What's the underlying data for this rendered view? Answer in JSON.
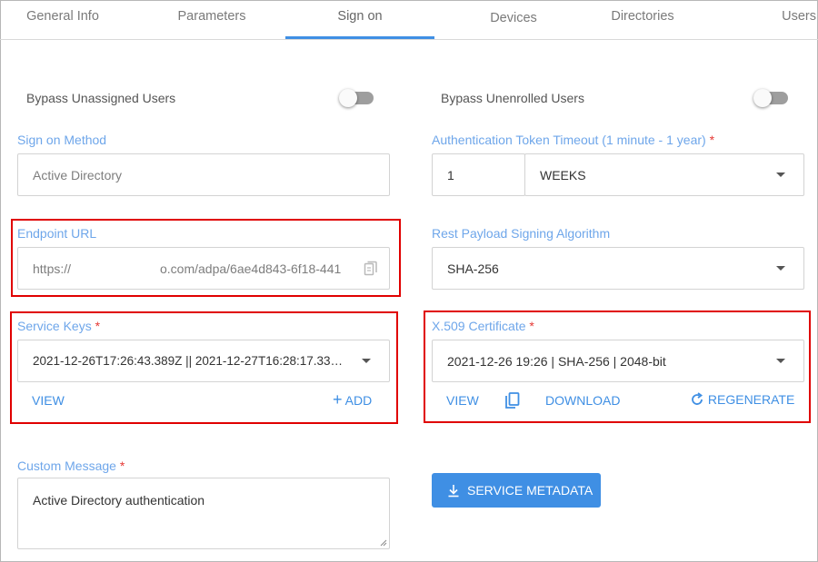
{
  "tabs": [
    {
      "label": "General Info"
    },
    {
      "label": "Parameters"
    },
    {
      "label": "Sign on"
    },
    {
      "label": "Devices"
    },
    {
      "label": "Directories"
    },
    {
      "label": "Users"
    }
  ],
  "bypass_unassigned": {
    "label": "Bypass Unassigned Users",
    "enabled": false
  },
  "bypass_unenrolled": {
    "label": "Bypass Unenrolled Users",
    "enabled": false
  },
  "sign_on_method": {
    "label": "Sign on Method",
    "value": "Active Directory"
  },
  "auth_timeout": {
    "label": "Authentication Token Timeout (1 minute - 1 year)",
    "required_mark": "*",
    "amount": "1",
    "unit": "WEEKS"
  },
  "endpoint_url": {
    "label": "Endpoint URL",
    "value_prefix": "https://",
    "value_suffix": "o.com/adpa/6ae4d843-6f18-441"
  },
  "rest_payload": {
    "label": "Rest Payload Signing Algorithm",
    "value": "SHA-256"
  },
  "service_keys": {
    "label": "Service Keys",
    "required_mark": "*",
    "value": "2021-12-26T17:26:43.389Z || 2021-12-27T16:28:17.33…",
    "view_label": "VIEW",
    "add_label": "ADD"
  },
  "x509": {
    "label": "X.509 Certificate",
    "required_mark": "*",
    "value": "2021-12-26 19:26 | SHA-256 | 2048-bit",
    "view_label": "VIEW",
    "download_label": "DOWNLOAD",
    "regenerate_label": "REGENERATE"
  },
  "custom_message": {
    "label": "Custom Message",
    "required_mark": "*",
    "value": "Active Directory authentication"
  },
  "service_metadata": {
    "label": "SERVICE METADATA"
  },
  "colors": {
    "accent": "#3f8fe4",
    "label": "#6ea6ea",
    "highlight": "#e00000",
    "required": "#e53935"
  },
  "icons": [
    "copy-icon",
    "chevron-down-icon",
    "plus-icon",
    "regenerate-icon",
    "download-icon"
  ]
}
